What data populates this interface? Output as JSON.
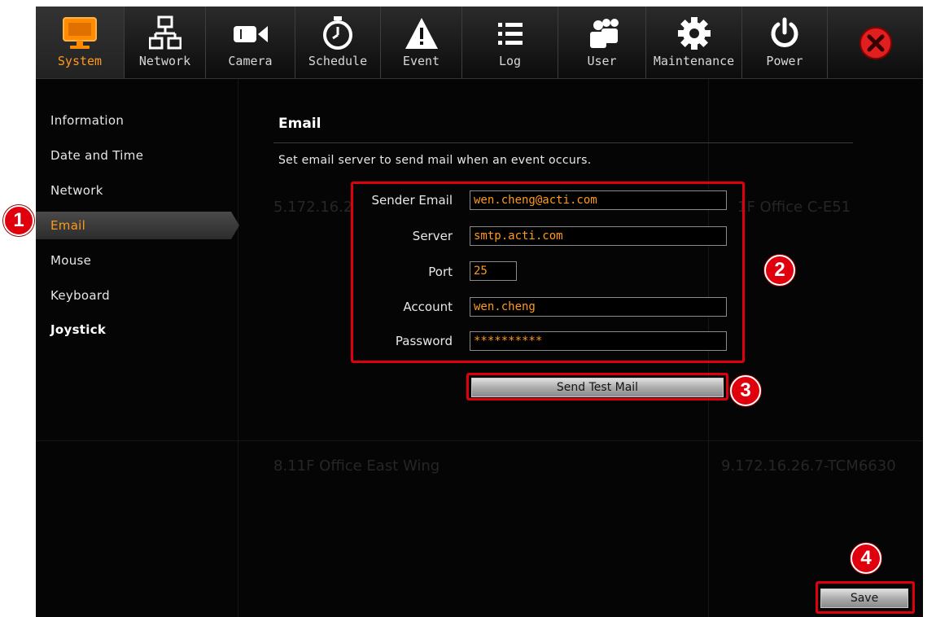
{
  "toolbar": {
    "tabs": [
      {
        "label": "System",
        "icon": "monitor-icon",
        "active": true
      },
      {
        "label": "Network",
        "icon": "network-icon"
      },
      {
        "label": "Camera",
        "icon": "camera-icon"
      },
      {
        "label": "Schedule",
        "icon": "clock-icon"
      },
      {
        "label": "Event",
        "icon": "warning-icon"
      },
      {
        "label": "Log",
        "icon": "list-icon"
      },
      {
        "label": "User",
        "icon": "users-icon"
      },
      {
        "label": "Maintenance",
        "icon": "gear-icon"
      },
      {
        "label": "Power",
        "icon": "power-icon"
      }
    ],
    "close_icon": "close-icon"
  },
  "sidebar": {
    "items": [
      {
        "label": "Information"
      },
      {
        "label": "Date and Time"
      },
      {
        "label": "Network"
      },
      {
        "label": "Email",
        "active": true
      },
      {
        "label": "Mouse"
      },
      {
        "label": "Keyboard"
      },
      {
        "label": "Joystick"
      }
    ]
  },
  "background": {
    "texts": [
      "5.172.16.2",
      "1F Office C-E51",
      "8.11F Office East Wing",
      "9.172.16.26.7-TCM6630"
    ]
  },
  "email": {
    "heading": "Email",
    "description": "Set email server to send mail when an event occurs.",
    "sender_email": {
      "label": "Sender Email",
      "value": "wen.cheng@acti.com"
    },
    "server": {
      "label": "Server",
      "value": "smtp.acti.com"
    },
    "port": {
      "label": "Port",
      "value": "25"
    },
    "account": {
      "label": "Account",
      "value": "wen.cheng"
    },
    "password": {
      "label": "Password",
      "value": "**********"
    },
    "send_test_label": "Send Test Mail",
    "save_label": "Save"
  },
  "annotations": {
    "step1": "1",
    "step2": "2",
    "step3": "3",
    "step4": "4"
  },
  "colors": {
    "accent": "#ff9a1a",
    "highlight_red": "#e0000d",
    "background": "#050505"
  }
}
